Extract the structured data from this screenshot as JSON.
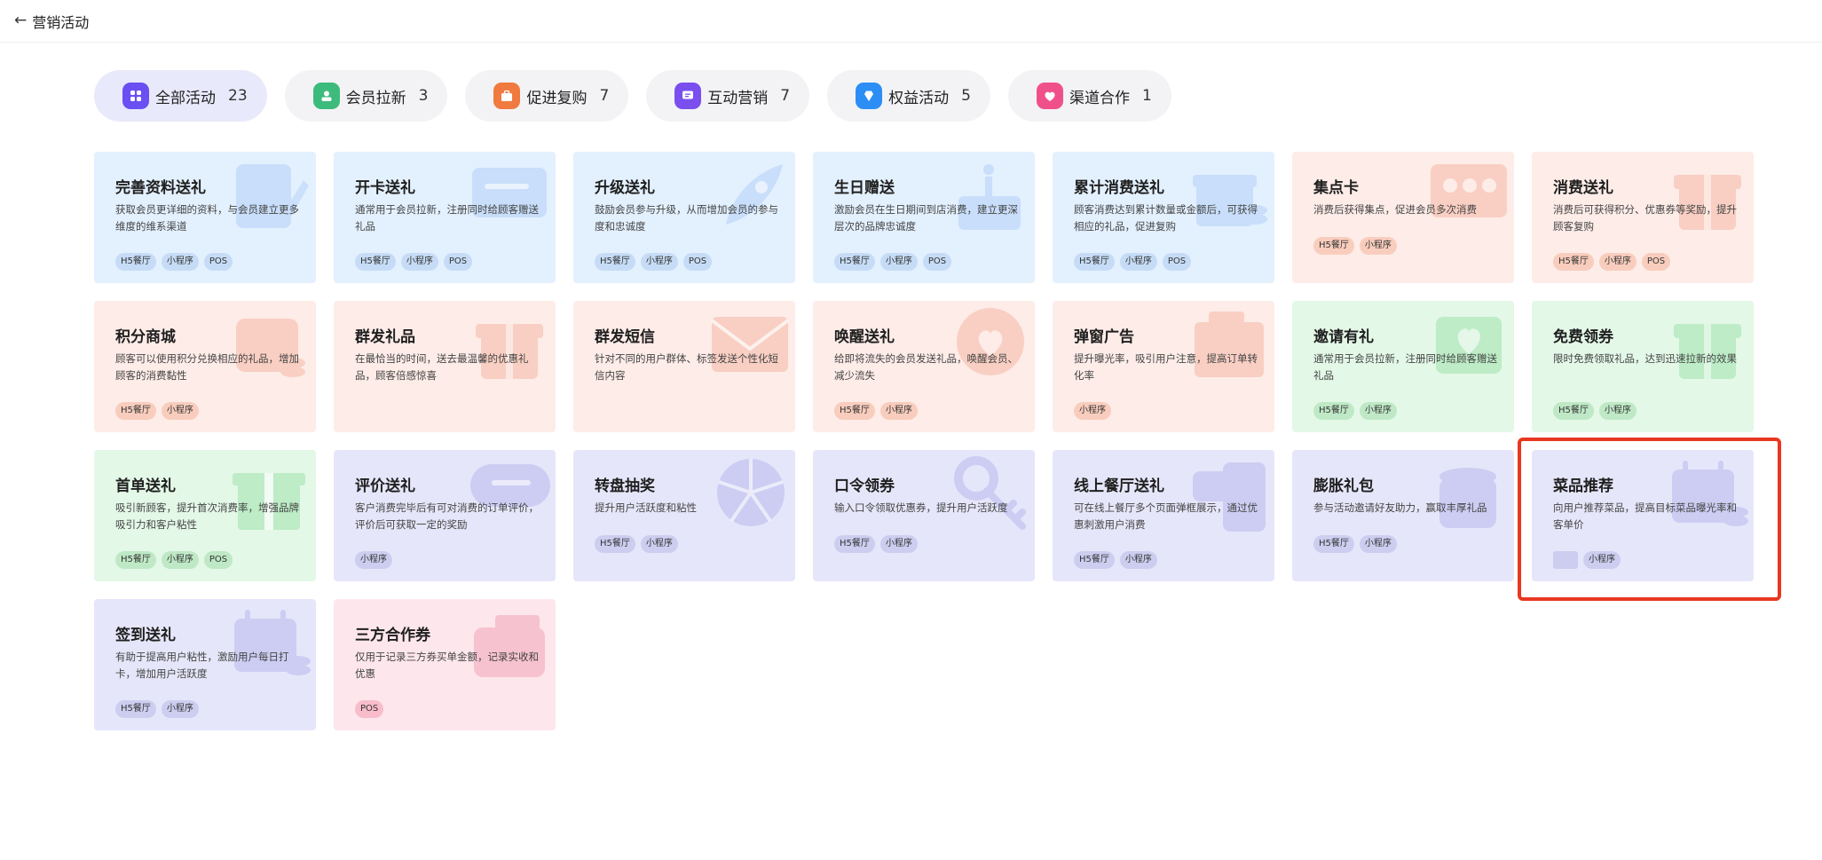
{
  "header": {
    "back_icon": "arrow-left-icon",
    "title": "营销活动"
  },
  "tabs": [
    {
      "label": "全部活动",
      "count": "23",
      "icon": "grid-icon",
      "color": "#6a4ff2",
      "active": true
    },
    {
      "label": "会员拉新",
      "count": "3",
      "icon": "member-icon",
      "color": "#3dbb7d",
      "active": false
    },
    {
      "label": "促进复购",
      "count": "7",
      "icon": "briefcase-icon",
      "color": "#f07a3f",
      "active": false
    },
    {
      "label": "互动营销",
      "count": "7",
      "icon": "chat-icon",
      "color": "#7a4ff0",
      "active": false
    },
    {
      "label": "权益活动",
      "count": "5",
      "icon": "diamond-icon",
      "color": "#2c8ef5",
      "active": false
    },
    {
      "label": "渠道合作",
      "count": "1",
      "icon": "heart-icon",
      "color": "#f0508a",
      "active": false
    }
  ],
  "cards": [
    {
      "title": "完善资料送礼",
      "desc": "获取会员更详细的资料，与会员建立更多维度的维系渠道",
      "tags": [
        "H5餐厅",
        "小程序",
        "POS"
      ],
      "theme": "blue",
      "icon": "profile-edit-icon"
    },
    {
      "title": "开卡送礼",
      "desc": "通常用于会员拉新，注册同时给顾客赠送礼品",
      "tags": [
        "H5餐厅",
        "小程序",
        "POS"
      ],
      "theme": "blue",
      "icon": "card-icon"
    },
    {
      "title": "升级送礼",
      "desc": "鼓励会员参与升级，从而增加会员的参与度和忠诚度",
      "tags": [
        "H5餐厅",
        "小程序",
        "POS"
      ],
      "theme": "blue",
      "icon": "rocket-icon"
    },
    {
      "title": "生日赠送",
      "desc": "激励会员在生日期间到店消费，建立更深层次的品牌忠诚度",
      "tags": [
        "H5餐厅",
        "小程序",
        "POS"
      ],
      "theme": "blue",
      "icon": "cake-icon"
    },
    {
      "title": "累计消费送礼",
      "desc": "顾客消费达到累计数量或金额后，可获得相应的礼品，促进复购",
      "tags": [
        "H5餐厅",
        "小程序",
        "POS"
      ],
      "theme": "blue",
      "icon": "gift-coins-icon"
    },
    {
      "title": "集点卡",
      "desc": "消费后获得集点，促进会员多次消费",
      "tags": [
        "H5餐厅",
        "小程序"
      ],
      "theme": "peach",
      "icon": "stamp-card-icon"
    },
    {
      "title": "消费送礼",
      "desc": "消费后可获得积分、优惠券等奖励，提升顾客复购",
      "tags": [
        "H5餐厅",
        "小程序",
        "POS"
      ],
      "theme": "peach",
      "icon": "gift-box-icon"
    },
    {
      "title": "积分商城",
      "desc": "顾客可以使用积分兑换相应的礼品，增加顾客的消费黏性",
      "tags": [
        "H5餐厅",
        "小程序"
      ],
      "theme": "peach",
      "icon": "store-coins-icon"
    },
    {
      "title": "群发礼品",
      "desc": "在最恰当的时间，送去最温馨的优惠礼品，顾客倍感惊喜",
      "tags": [],
      "theme": "peach",
      "icon": "gift-box-icon"
    },
    {
      "title": "群发短信",
      "desc": "针对不同的用户群体、标签发送个性化短信内容",
      "tags": [],
      "theme": "peach",
      "icon": "envelope-icon"
    },
    {
      "title": "唤醒送礼",
      "desc": "给即将流失的会员发送礼品，唤醒会员、减少流失",
      "tags": [
        "H5餐厅",
        "小程序"
      ],
      "theme": "peach",
      "icon": "heart-bubble-icon"
    },
    {
      "title": "弹窗广告",
      "desc": "提升曝光率，吸引用户注意，提高订单转化率",
      "tags": [
        "小程序"
      ],
      "theme": "peach",
      "icon": "popup-icon"
    },
    {
      "title": "邀请有礼",
      "desc": "通常用于会员拉新，注册同时给顾客赠送礼品",
      "tags": [
        "H5餐厅",
        "小程序"
      ],
      "theme": "green",
      "icon": "invite-heart-icon"
    },
    {
      "title": "免费领券",
      "desc": "限时免费领取礼品，达到迅速拉新的效果",
      "tags": [
        "H5餐厅",
        "小程序"
      ],
      "theme": "green",
      "icon": "gift-box-icon"
    },
    {
      "title": "首单送礼",
      "desc": "吸引新顾客，提升首次消费率，增强品牌吸引力和客户粘性",
      "tags": [
        "H5餐厅",
        "小程序",
        "POS"
      ],
      "theme": "green",
      "icon": "gift-ribbon-icon"
    },
    {
      "title": "评价送礼",
      "desc": "客户消费完毕后有可对消费的订单评价，评价后可获取一定的奖励",
      "tags": [
        "小程序"
      ],
      "theme": "lav",
      "icon": "comment-icon"
    },
    {
      "title": "转盘抽奖",
      "desc": "提升用户活跃度和粘性",
      "tags": [
        "H5餐厅",
        "小程序"
      ],
      "theme": "lav",
      "icon": "wheel-icon"
    },
    {
      "title": "口令领券",
      "desc": "输入口令领取优惠券，提升用户活跃度",
      "tags": [
        "H5餐厅",
        "小程序"
      ],
      "theme": "lav",
      "icon": "key-icon"
    },
    {
      "title": "线上餐厅送礼",
      "desc": "可在线上餐厅多个页面弹框展示，通过优惠刺激用户消费",
      "tags": [
        "H5餐厅",
        "小程序"
      ],
      "theme": "lav",
      "icon": "phone-icon"
    },
    {
      "title": "膨胀礼包",
      "desc": "参与活动邀请好友助力，赢取丰厚礼品",
      "tags": [
        "H5餐厅",
        "小程序"
      ],
      "theme": "lav",
      "icon": "bag-icon"
    },
    {
      "title": "菜品推荐",
      "desc": "向用户推荐菜品，提高目标菜品曝光率和客单价",
      "tags": [
        "",
        "小程序"
      ],
      "theme": "lav",
      "icon": "calendar-coins-icon"
    },
    {
      "title": "签到送礼",
      "desc": "有助于提高用户粘性，激励用户每日打卡，增加用户活跃度",
      "tags": [
        "H5餐厅",
        "小程序"
      ],
      "theme": "lav",
      "icon": "calendar-coins-icon"
    },
    {
      "title": "三方合作券",
      "desc": "仅用于记录三方券买单金额，记录实收和优惠",
      "tags": [
        "POS"
      ],
      "theme": "pink",
      "icon": "wallet-icon"
    }
  ],
  "highlight_color": "#e8371f"
}
